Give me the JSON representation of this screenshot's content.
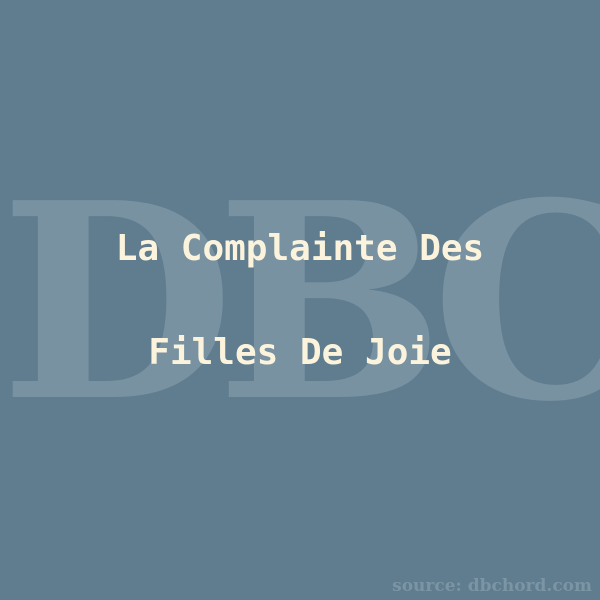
{
  "watermark": {
    "text": "DBC"
  },
  "title": {
    "line1": "La Complainte Des",
    "line2": "Filles De Joie"
  },
  "source": {
    "text": "source: dbchord.com"
  },
  "colors": {
    "background": "#5f7d8f",
    "watermark": "#7892a2",
    "title_text": "#fbf3dc",
    "source_text": "#7b95a5"
  }
}
